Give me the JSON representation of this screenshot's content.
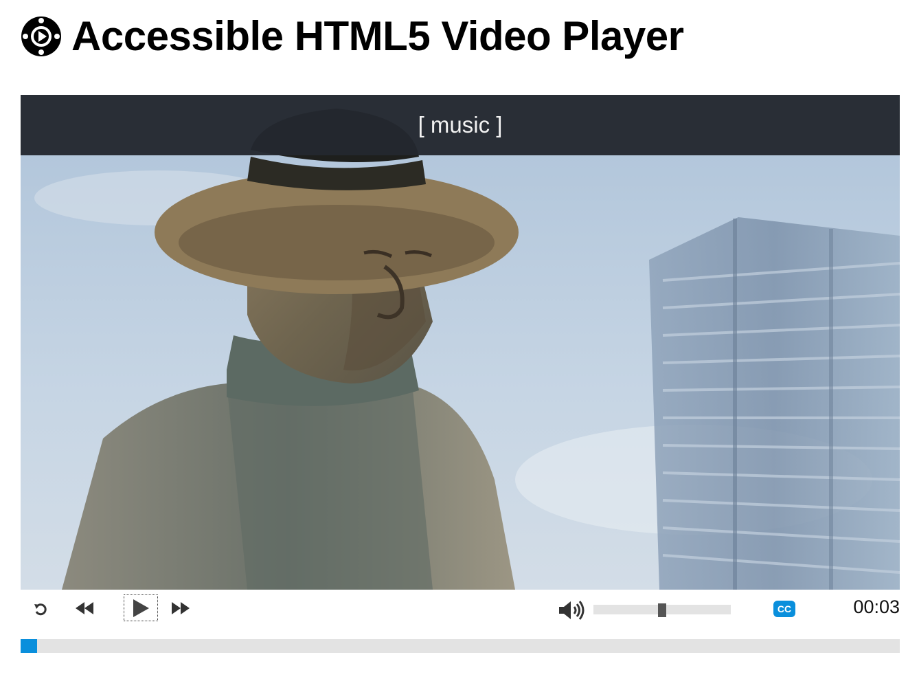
{
  "page": {
    "title": "Accessible HTML5 Video Player"
  },
  "player": {
    "caption": "[ music ]",
    "current_time": "00:03",
    "progress": 0.019,
    "volume_level": 0.5,
    "accent_color": "#0a8fdc",
    "icons": {
      "logo": "video-player-logo-icon",
      "restart": "restart-icon",
      "rewind": "rewind-icon",
      "play": "play-icon",
      "fast_forward": "fast-forward-icon",
      "volume": "volume-icon",
      "captions": "closed-captions-icon"
    }
  }
}
